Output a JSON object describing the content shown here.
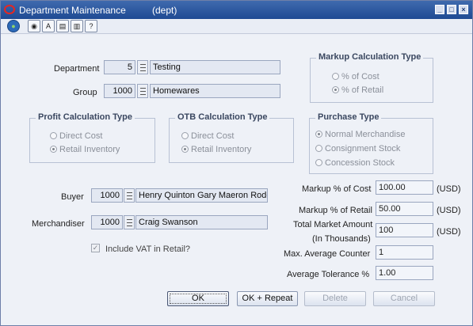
{
  "window": {
    "title": "Department Maintenance",
    "subtitle": "(dept)",
    "controls": {
      "minimize": "_",
      "maximize": "□",
      "close": "×"
    }
  },
  "toolbar": {
    "icons": [
      "globe-icon",
      "navigate-icon",
      "lov-icon",
      "copy-icon",
      "print-icon",
      "help-icon"
    ],
    "glyphs": [
      "●",
      "◉",
      "A",
      "▤",
      "▥",
      "?"
    ]
  },
  "department": {
    "dept_label": "Department",
    "dept_no": "5",
    "dept_name": "Testing",
    "group_label": "Group",
    "group_no": "1000",
    "group_name": "Homewares"
  },
  "markup_type": {
    "legend": "Markup Calculation Type",
    "options": [
      "% of Cost",
      "% of Retail"
    ],
    "selected_index": 1
  },
  "profit_type": {
    "legend": "Profit Calculation Type",
    "options": [
      "Direct Cost",
      "Retail Inventory"
    ],
    "selected_index": 1
  },
  "otb_type": {
    "legend": "OTB Calculation Type",
    "options": [
      "Direct Cost",
      "Retail Inventory"
    ],
    "selected_index": 1
  },
  "purchase_type": {
    "legend": "Purchase Type",
    "options": [
      "Normal Merchandise",
      "Consignment Stock",
      "Concession Stock"
    ],
    "selected_index": 0
  },
  "people": {
    "buyer_label": "Buyer",
    "buyer_no": "1000",
    "buyer_name": "Henry Quinton Gary Maeron Rode",
    "merch_label": "Merchandiser",
    "merch_no": "1000",
    "merch_name": "Craig Swanson",
    "vat_label": "Include VAT in Retail?",
    "vat_checked": true
  },
  "metrics": {
    "markup_cost_label": "Markup % of Cost",
    "markup_cost": "100.00",
    "markup_retail_label": "Markup % of Retail",
    "markup_retail": "50.00",
    "total_market_label_1": "Total Market Amount",
    "total_market_label_2": "(In Thousands)",
    "total_market": "100",
    "max_avg_label": "Max. Average Counter",
    "max_avg": "1",
    "avg_tol_label": "Average Tolerance %",
    "avg_tol": "1.00",
    "currency": "(USD)"
  },
  "buttons": {
    "ok": "OK",
    "ok_repeat": "OK + Repeat",
    "delete": "Delete",
    "cancel": "Cancel"
  }
}
